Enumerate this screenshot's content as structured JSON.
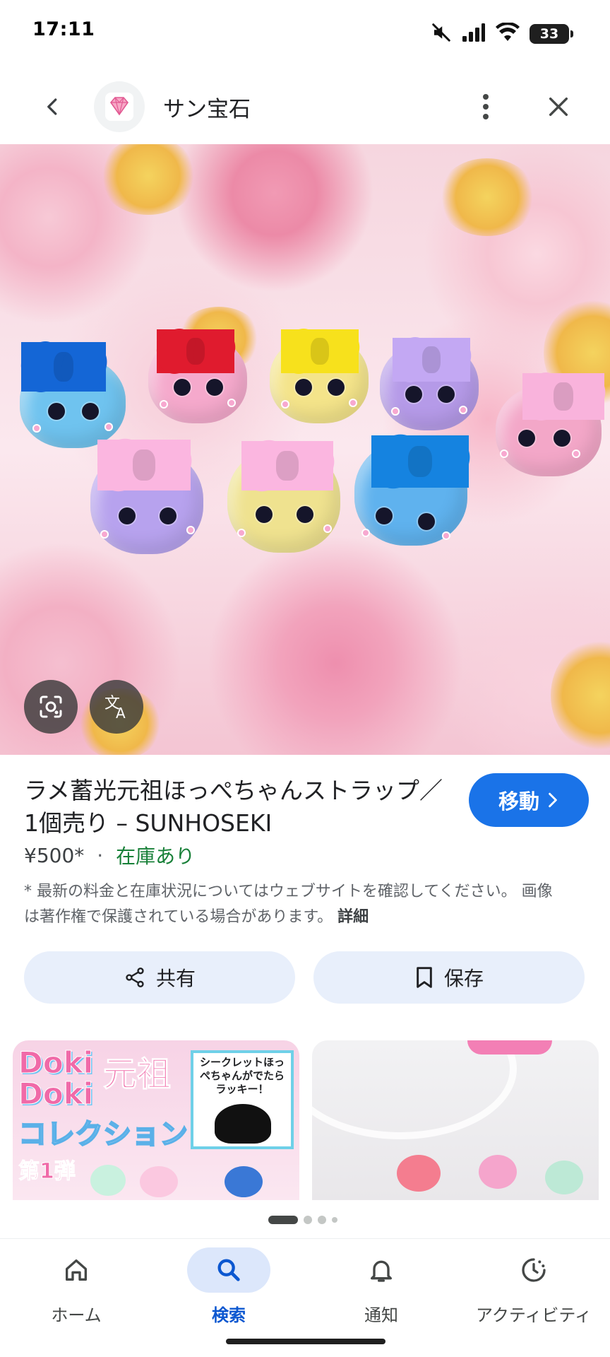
{
  "status_bar": {
    "time": "17:11",
    "battery": "33",
    "icons": [
      "mute-icon",
      "signal-icon",
      "wifi-icon",
      "battery-icon"
    ]
  },
  "header": {
    "site_name": "サン宝石",
    "icons": [
      "back-icon",
      "diamond-logo-icon",
      "more-vert-icon",
      "close-icon"
    ]
  },
  "product": {
    "title": "ラメ蓄光元祖ほっぺちゃんストラップ／1個売り – SUNHOSEKI",
    "price": "¥500*",
    "separator": "·",
    "stock": "在庫あり",
    "disclaimer": "* 最新の料金と在庫状況についてはウェブサイトを確認してください。 画像は著作権で保護されている場合があります。",
    "details_link": "詳細"
  },
  "actions": {
    "goto_label": "移動",
    "share_label": "共有",
    "save_label": "保存"
  },
  "related": {
    "card1": {
      "title_line1": "Doki",
      "title_line2": "Doki",
      "title_right": "元祖",
      "subtitle": "コレクション",
      "box_text": "シークレットほっぺちゃんがでたらラッキー！",
      "badge": "第1弾"
    }
  },
  "bottom_nav": {
    "items": [
      {
        "label": "ホーム",
        "icon": "home-icon"
      },
      {
        "label": "検索",
        "icon": "search-icon",
        "active": true
      },
      {
        "label": "通知",
        "icon": "bell-icon"
      },
      {
        "label": "アクティビティ",
        "icon": "activity-icon"
      }
    ]
  },
  "colors": {
    "accent": "#1a73e8",
    "stock_green": "#188038",
    "chip_bg": "#e8effb"
  }
}
